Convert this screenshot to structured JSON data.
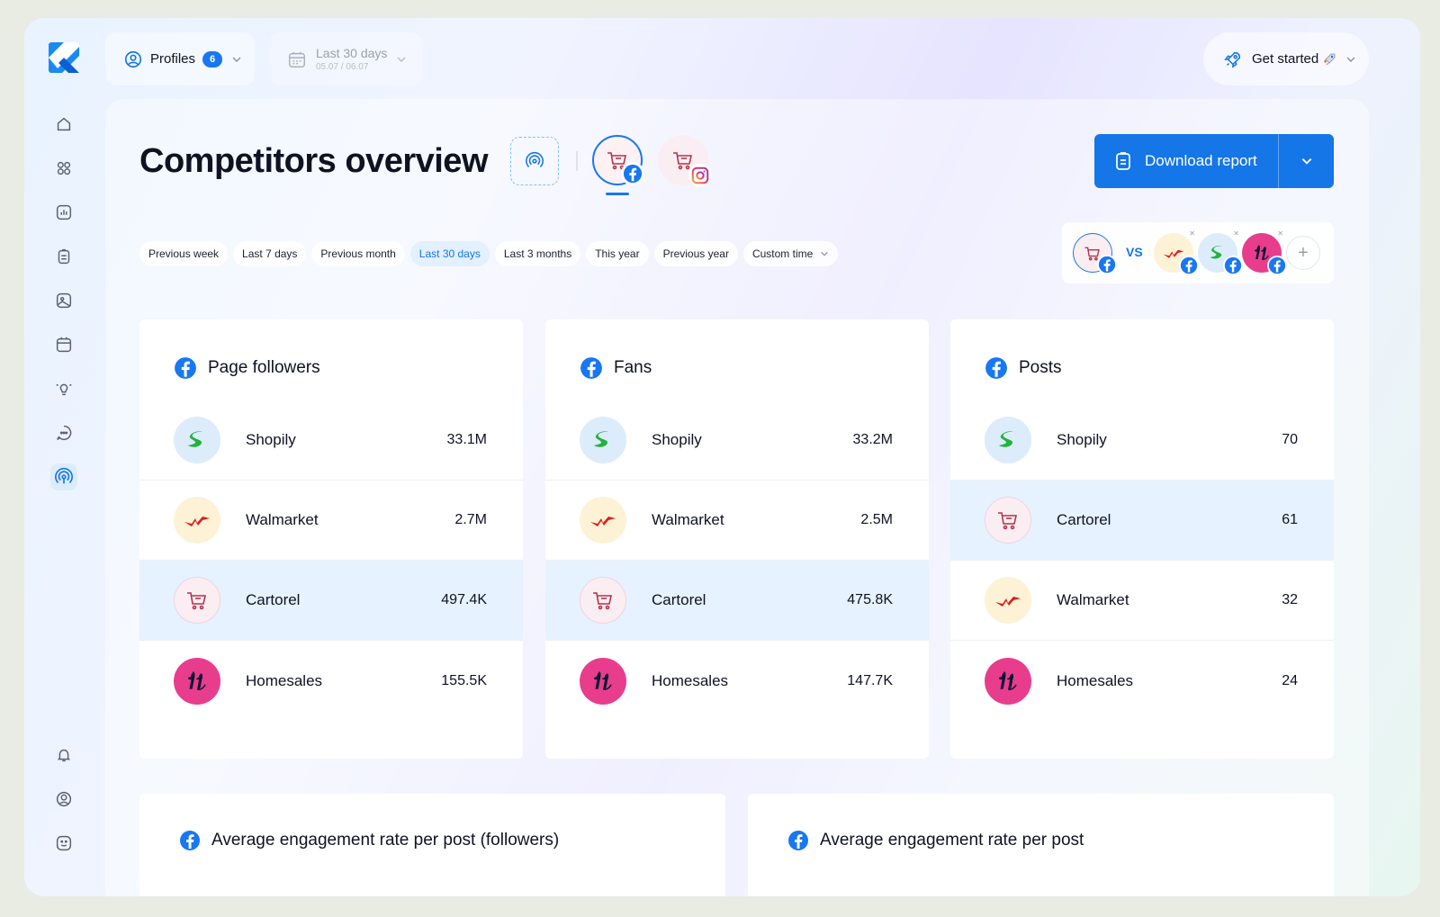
{
  "topbar": {
    "profiles_label": "Profiles",
    "profiles_count": "6",
    "daterange_label": "Last 30 days",
    "daterange_sub": "05.07 / 06.07",
    "get_started_label": "Get started"
  },
  "sidebar": {
    "items": [
      "home-icon",
      "apps-grid-icon",
      "analytics-icon",
      "clipboard-icon",
      "image-icon",
      "calendar-icon",
      "bulb-icon",
      "chat-icon",
      "competitors-icon"
    ],
    "bottom": [
      "bell-icon",
      "user-circle-icon",
      "smile-icon"
    ],
    "active": "competitors-icon"
  },
  "page": {
    "title": "Competitors overview",
    "download_label": "Download report"
  },
  "timeframes": [
    {
      "label": "Previous week",
      "active": false
    },
    {
      "label": "Last 7 days",
      "active": false
    },
    {
      "label": "Previous month",
      "active": false
    },
    {
      "label": "Last 30 days",
      "active": true
    },
    {
      "label": "Last 3 months",
      "active": false
    },
    {
      "label": "This year",
      "active": false
    },
    {
      "label": "Previous year",
      "active": false
    },
    {
      "label": "Custom time",
      "active": false
    }
  ],
  "compare": {
    "vs_label": "VS"
  },
  "cards": [
    {
      "title": "Page followers",
      "rows": [
        {
          "name": "Shopily",
          "value": "33.1M"
        },
        {
          "name": "Walmarket",
          "value": "2.7M"
        },
        {
          "name": "Cartorel",
          "value": "497.4K"
        },
        {
          "name": "Homesales",
          "value": "155.5K"
        }
      ]
    },
    {
      "title": "Fans",
      "rows": [
        {
          "name": "Shopily",
          "value": "33.2M"
        },
        {
          "name": "Walmarket",
          "value": "2.5M"
        },
        {
          "name": "Cartorel",
          "value": "475.8K"
        },
        {
          "name": "Homesales",
          "value": "147.7K"
        }
      ]
    },
    {
      "title": "Posts",
      "rows": [
        {
          "name": "Shopily",
          "value": "70"
        },
        {
          "name": "Cartorel",
          "value": "61"
        },
        {
          "name": "Walmarket",
          "value": "32"
        },
        {
          "name": "Homesales",
          "value": "24"
        }
      ]
    }
  ],
  "bottom_cards": [
    {
      "title": "Average engagement rate per post (followers)"
    },
    {
      "title": "Average engagement rate per post"
    }
  ],
  "colors": {
    "accent": "#1576e8",
    "facebook": "#1877f2",
    "highlight": "#e6f2ff"
  }
}
